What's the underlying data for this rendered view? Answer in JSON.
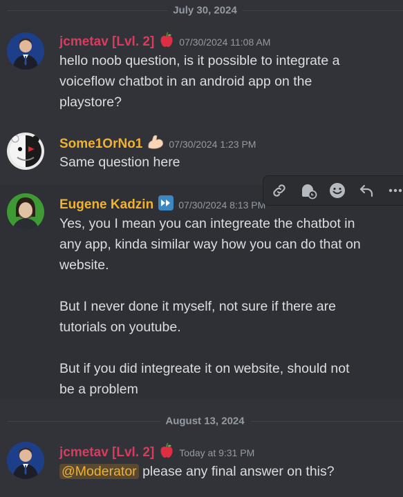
{
  "dividers": [
    {
      "label": "July 30, 2024"
    },
    {
      "label": "August 13, 2024"
    }
  ],
  "messages": [
    {
      "username": "jcmetav [Lvl. 2]",
      "username_color": "#d83c5e",
      "badge_icon": "apple-icon",
      "timestamp": "07/30/2024 11:08 AM",
      "lines": [
        "hello noob question, is it possible to integrate a",
        "voiceflow chatbot in an android app on the",
        "playstore?"
      ]
    },
    {
      "username": "Some1OrNo1",
      "username_color": "#f0b232",
      "badge_icon": "flexed-bicep-icon",
      "timestamp": "07/30/2024 1:23 PM",
      "lines": [
        "Same question here"
      ]
    },
    {
      "username": "Eugene Kadzin",
      "username_color": "#f0b232",
      "badge_icon": "fast-forward-icon",
      "timestamp": "07/30/2024 8:13 PM",
      "lines": [
        "Yes, you I mean you can integreate the chatbot in",
        "any app, kinda similar way how you can do that on",
        "website.",
        "",
        "But I never done it myself, not sure if there are",
        "tutorials on youtube.",
        "",
        "But if you did integreate it on website, should not",
        "be a problem"
      ]
    },
    {
      "username": "jcmetav [Lvl. 2]",
      "username_color": "#d83c5e",
      "badge_icon": "apple-icon",
      "timestamp": "Today at 9:31 PM",
      "mention": "@Moderator",
      "text_after_mention": " please any final answer on this?"
    }
  ],
  "toolbar": {
    "icons": [
      "link-icon",
      "thread-icon",
      "emoji-icon",
      "reply-icon",
      "more-icon"
    ]
  },
  "colors": {
    "background": "#313338",
    "hover_background": "#2e3035",
    "mention_text": "#f0b132",
    "timestamp": "#949ba4"
  }
}
